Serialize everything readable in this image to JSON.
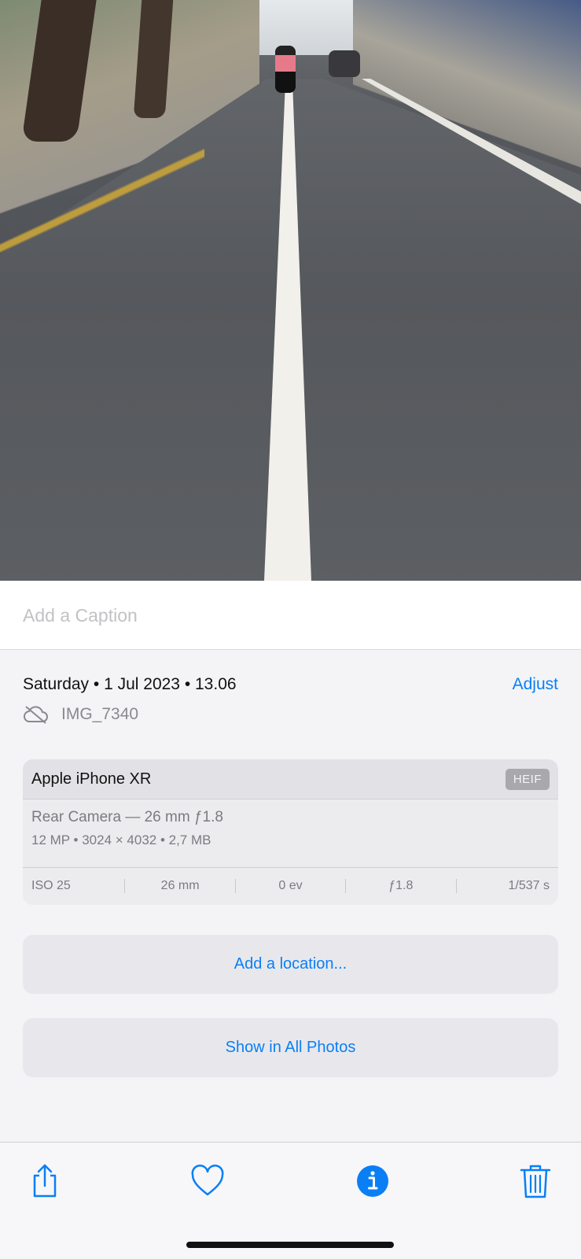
{
  "photo": {
    "icon": "street-photo"
  },
  "caption": {
    "placeholder": "Add a Caption"
  },
  "info": {
    "date_text": "Saturday • 1 Jul 2023 • 13.06",
    "adjust_label": "Adjust",
    "filename": "IMG_7340",
    "cloud_icon": "cloud-off-icon"
  },
  "camera": {
    "model": "Apple iPhone XR",
    "format": "HEIF",
    "lens": "Rear Camera — 26 mm ƒ1.8",
    "specs": "12 MP  •  3024 × 4032  •  2,7 MB",
    "exif": [
      "ISO 25",
      "26 mm",
      "0 ev",
      "ƒ1.8",
      "1/537 s"
    ]
  },
  "actions": {
    "add_location": "Add a location...",
    "show_all": "Show in All Photos"
  },
  "toolbar": {
    "share_icon": "share-icon",
    "favorite_icon": "heart-icon",
    "info_icon": "info-icon",
    "delete_icon": "trash-icon",
    "accent_color": "#0a7ff5"
  }
}
